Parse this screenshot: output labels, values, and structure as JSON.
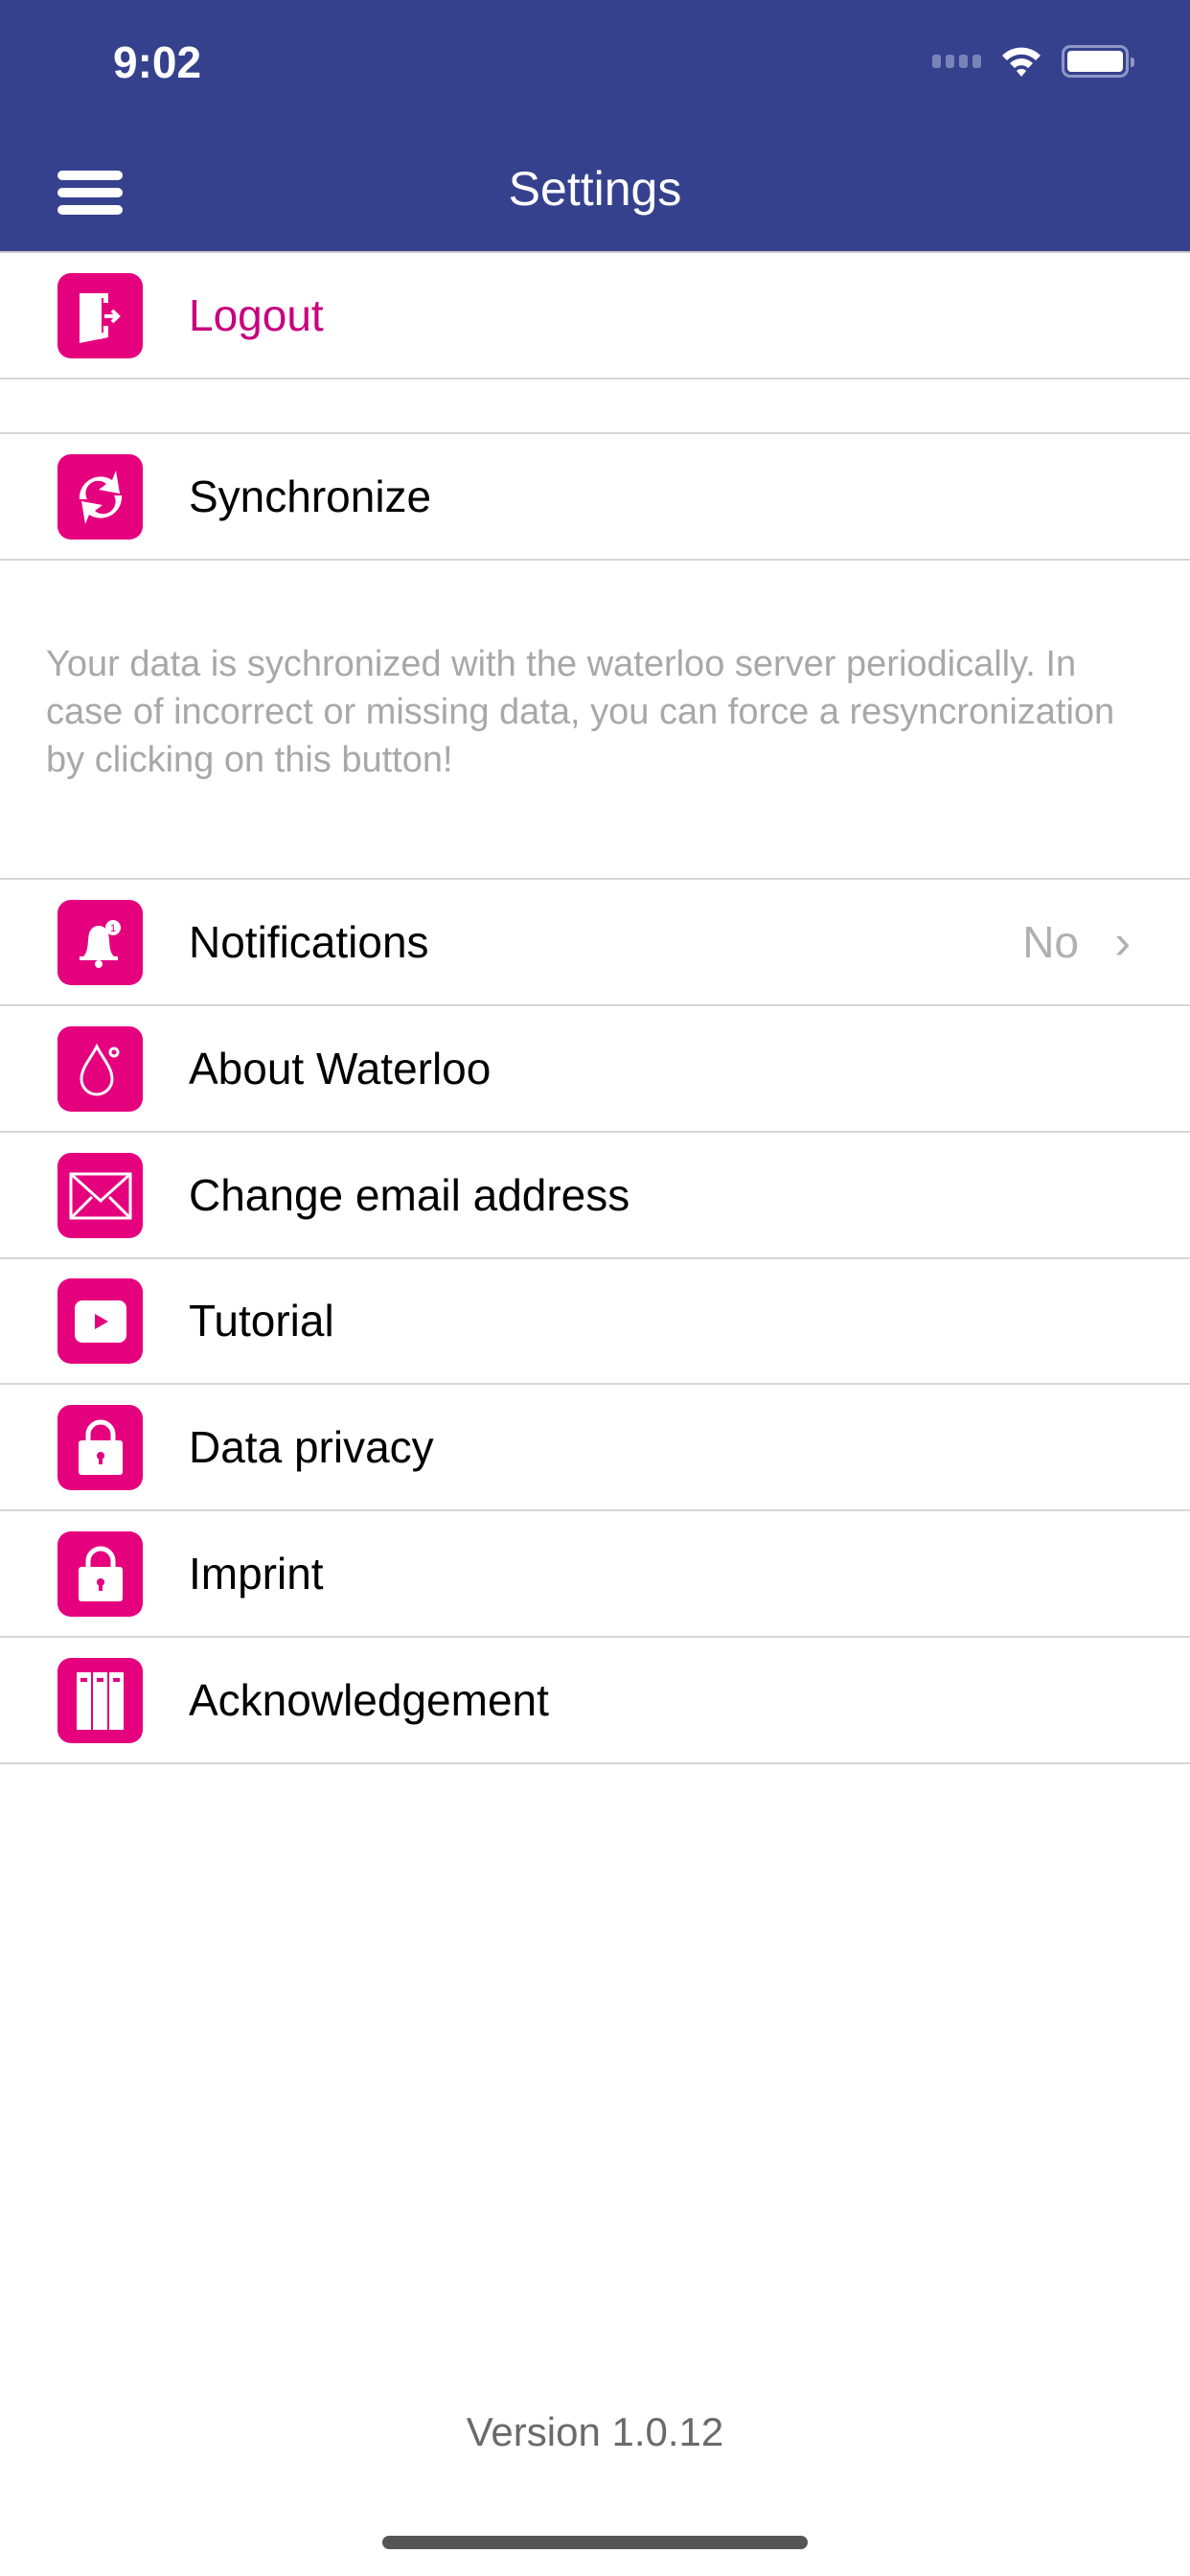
{
  "status_bar": {
    "time": "9:02"
  },
  "header": {
    "title": "Settings"
  },
  "logout": {
    "label": "Logout"
  },
  "sync": {
    "label": "Synchronize",
    "description": "Your data is sychronized with the waterloo server periodically. In case of incorrect or missing data, you can force a resyncronization by clicking on this button!"
  },
  "items": [
    {
      "label": "Notifications",
      "value": "No"
    },
    {
      "label": "About Waterloo"
    },
    {
      "label": "Change email address"
    },
    {
      "label": "Tutorial"
    },
    {
      "label": "Data privacy"
    },
    {
      "label": "Imprint"
    },
    {
      "label": "Acknowledgement"
    }
  ],
  "footer": {
    "version": "Version 1.0.12"
  },
  "colors": {
    "nav": "#36418e",
    "accent": "#e5007e",
    "logout_text": "#c8007f"
  }
}
